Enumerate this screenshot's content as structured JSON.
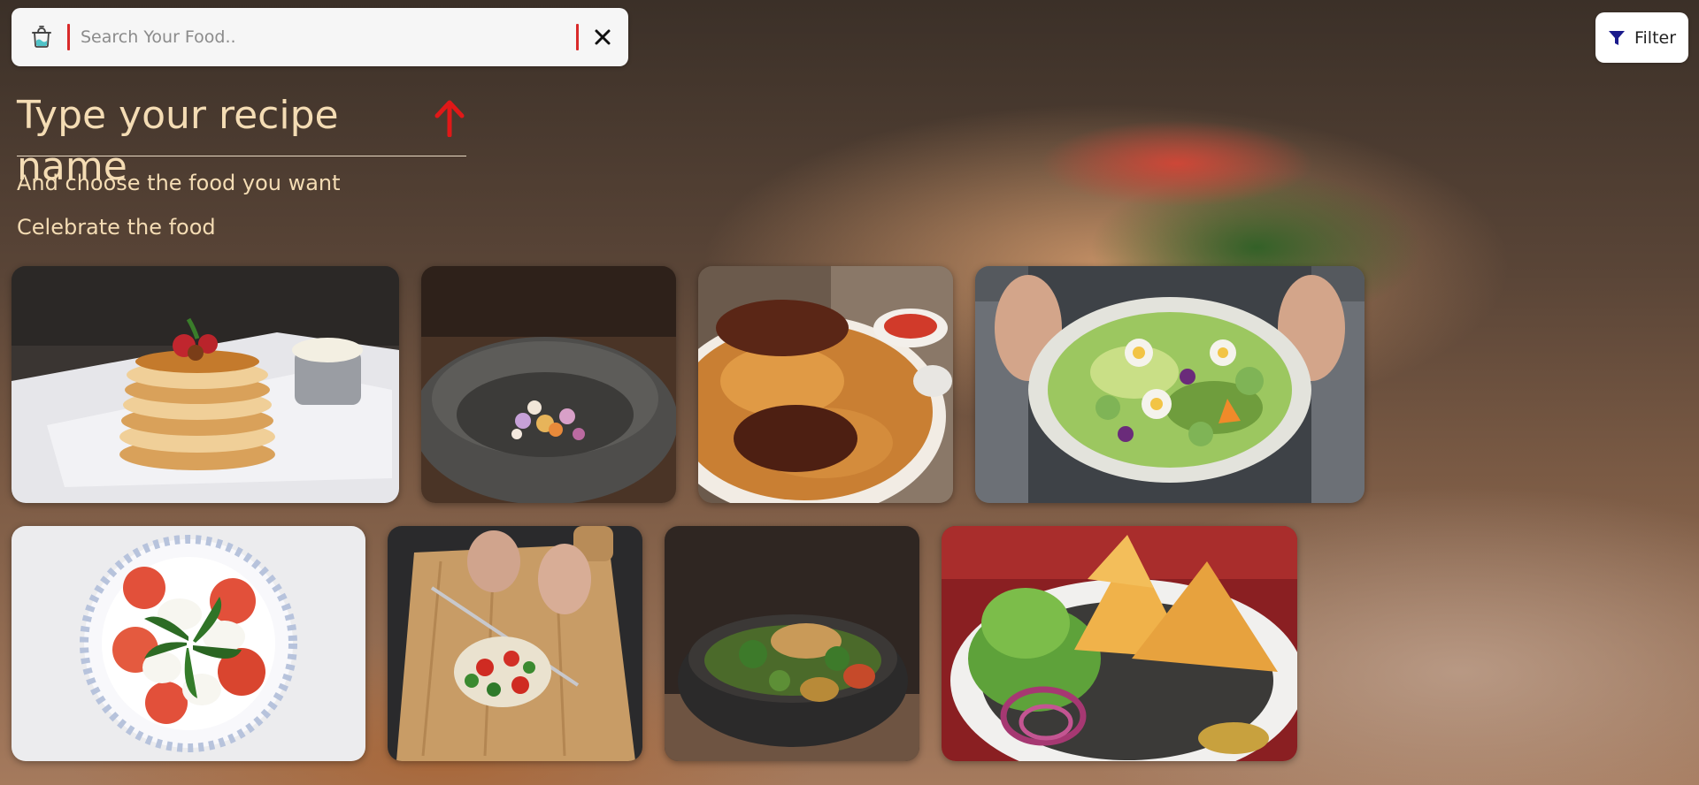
{
  "search": {
    "placeholder": "Search Your Food..",
    "value": ""
  },
  "filter": {
    "label": "Filter"
  },
  "hero": {
    "title": "Type your recipe name",
    "subtitle_1": "And choose the food you want",
    "subtitle_2": "Celebrate the food"
  },
  "colors": {
    "accent_red": "#d92a2a",
    "heading_text": "#f4dcb4",
    "filter_icon": "#1a1a8c"
  },
  "icons": {
    "app": "cooking-pot-icon",
    "clear": "close-icon",
    "filter": "funnel-icon",
    "hint": "up-arrow-icon"
  },
  "food_items": [
    {
      "id": "pancakes"
    },
    {
      "id": "mortar-bowl"
    },
    {
      "id": "biryani-chicken"
    },
    {
      "id": "green-salad"
    },
    {
      "id": "caprese-salad"
    },
    {
      "id": "chopping-board"
    },
    {
      "id": "noodle-bowl"
    },
    {
      "id": "samosa-plate"
    }
  ]
}
